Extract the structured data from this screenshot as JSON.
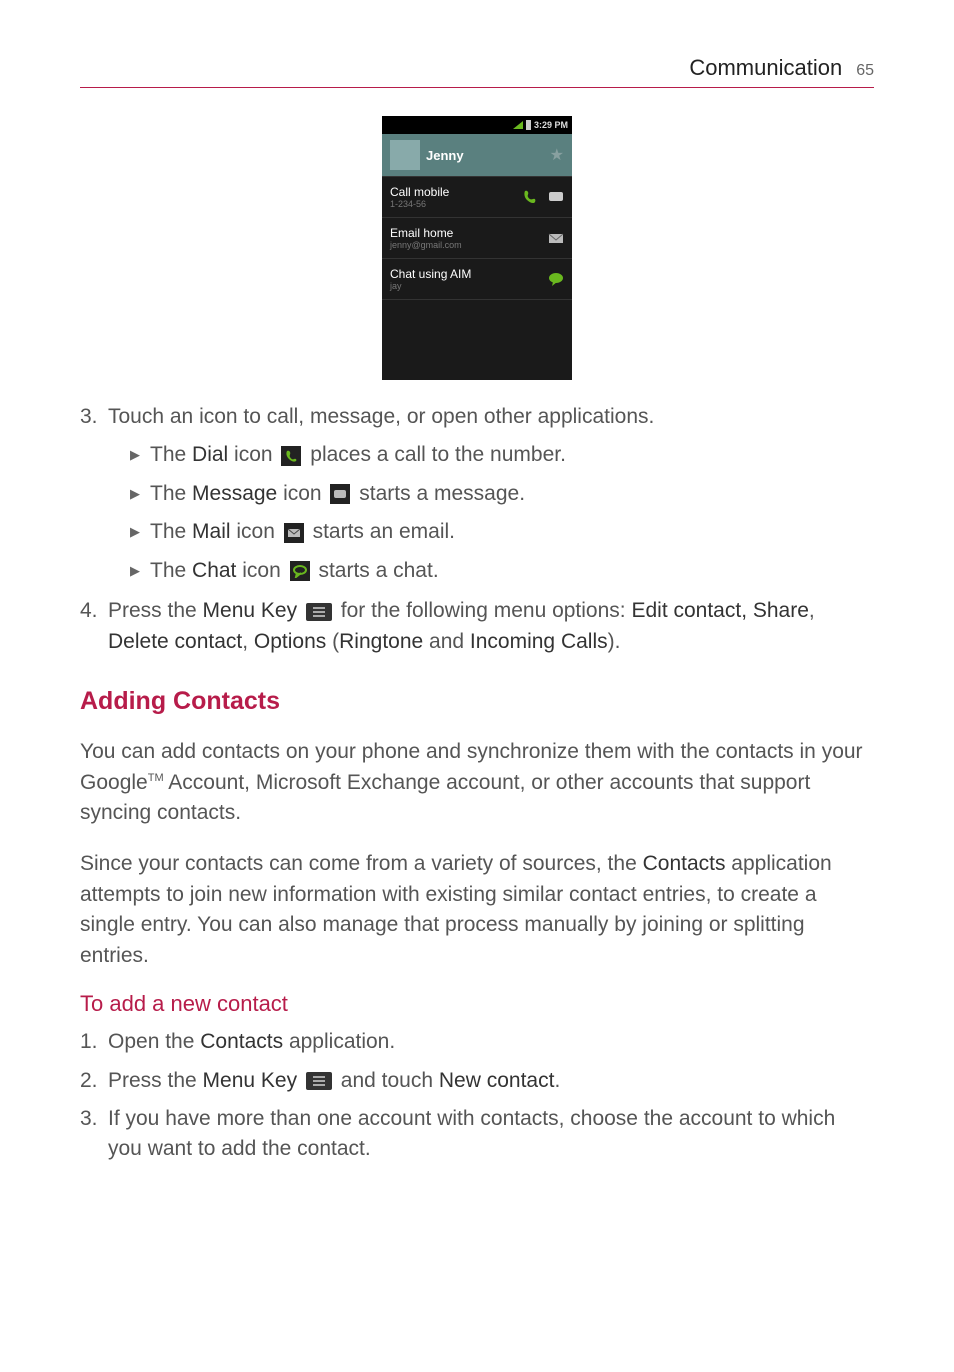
{
  "header": {
    "title": "Communication",
    "page_number": "65"
  },
  "screenshot": {
    "status_time": "3:29 PM",
    "contact_name": "Jenny",
    "rows": [
      {
        "title": "Call mobile",
        "sub": "1-234-56",
        "icon1": "phone",
        "icon2": "sms"
      },
      {
        "title": "Email home",
        "sub": "jenny@gmail.com",
        "icon1": null,
        "icon2": "mail"
      },
      {
        "title": "Chat using AIM",
        "sub": "jay",
        "icon1": null,
        "icon2": "chat"
      }
    ]
  },
  "step3": {
    "number": "3.",
    "text": "Touch an icon to call, message, or open other applications.",
    "bullets": [
      {
        "label": "Dial",
        "pre": "The ",
        "post_icon": "dial",
        "rest": " places a call to the number."
      },
      {
        "label": "Message",
        "pre": "The ",
        "post_icon": "message",
        "rest": " starts a message."
      },
      {
        "label": "Mail",
        "pre": "The ",
        "post_icon": "mail",
        "rest": " starts an email."
      },
      {
        "label": "Chat",
        "pre": "The ",
        "post_icon": "chat",
        "rest": " starts a chat."
      }
    ]
  },
  "step4": {
    "number": "4.",
    "pre": "Press the ",
    "menu_key": "Menu Key",
    "mid": " for the following menu options: ",
    "opts_line1_end": "Edit contact,",
    "opts_line2_and": " and ",
    "share": "Share",
    "delete_contact": "Delete contact",
    "options": "Options",
    "ringtone": "Ringtone",
    "incoming": "Incoming Calls",
    "close": ")."
  },
  "section_heading": "Adding Contacts",
  "para1_pre": "You can add contacts on your phone and synchronize them with the contacts in your Google",
  "para1_post": " Account, Microsoft Exchange account, or other accounts that support syncing contacts.",
  "para2_a": "Since your contacts can come from a variety of sources, the ",
  "contacts_word": "Contacts",
  "para2_b": " application attempts to join new information with existing similar contact entries, to create a single entry. You can also manage that process manually by joining or splitting entries.",
  "subsection_heading": "To add a new contact",
  "sub_step1": {
    "num": "1.",
    "pre": "Open the ",
    "contacts": "Contacts",
    "post": " application."
  },
  "sub_step2": {
    "num": "2.",
    "pre": "Press the ",
    "menu_key": "Menu Key",
    "mid": " and touch ",
    "new_contact": "New contact",
    "post": "."
  },
  "sub_step3": {
    "num": "3.",
    "text": "If you have more than one account with contacts, choose the account to which you want to add the contact."
  }
}
